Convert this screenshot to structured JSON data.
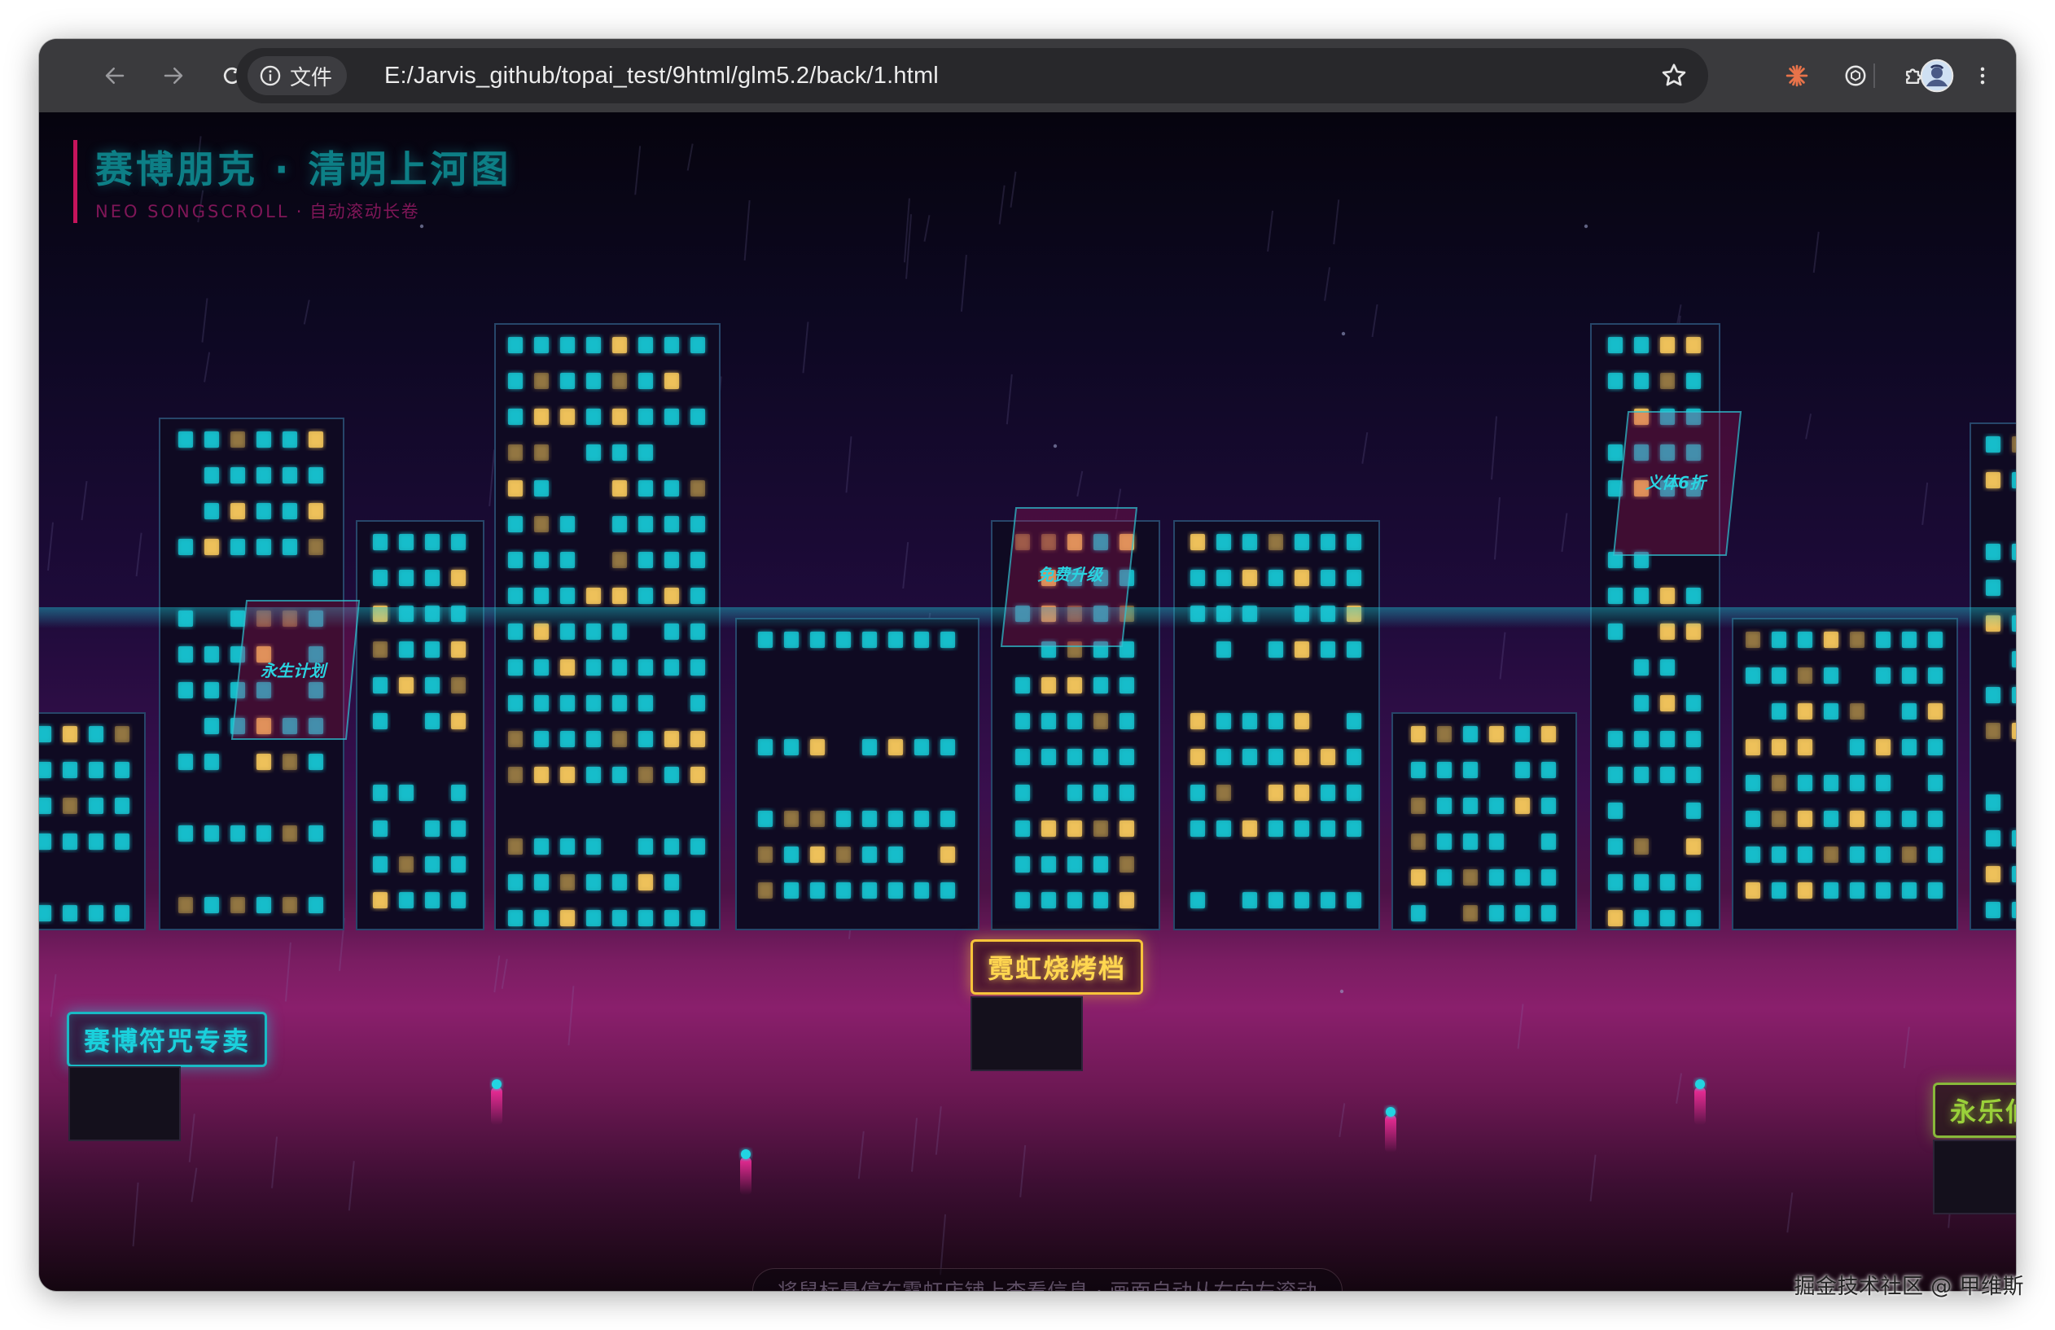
{
  "browser": {
    "site_label": "文件",
    "url": "E:/Jarvis_github/topai_test/9html/glm5.2/back/1.html"
  },
  "page": {
    "title": "赛博朋克 · 清明上河图",
    "subtitle_en": "NEO SONGSCROLL",
    "subtitle_sep": " · ",
    "subtitle_cn": "自动滚动长卷",
    "billboards": [
      "永生计划",
      "免费升级",
      "义体6折"
    ],
    "store_signs": {
      "left": "赛博符咒专卖",
      "center": "霓虹烧烤档",
      "right": "永乐仙"
    },
    "hint": "将鼠标悬停在霓虹店铺上查看信息 · 画面自动从右向左滚动"
  },
  "colors": {
    "neon_teal": "#1ad1dc",
    "neon_yellow": "#f7c43a",
    "neon_magenta": "#e0208c",
    "neon_green": "#9ad03a"
  },
  "watermark": "掘金技术社区 @ 甲维斯"
}
